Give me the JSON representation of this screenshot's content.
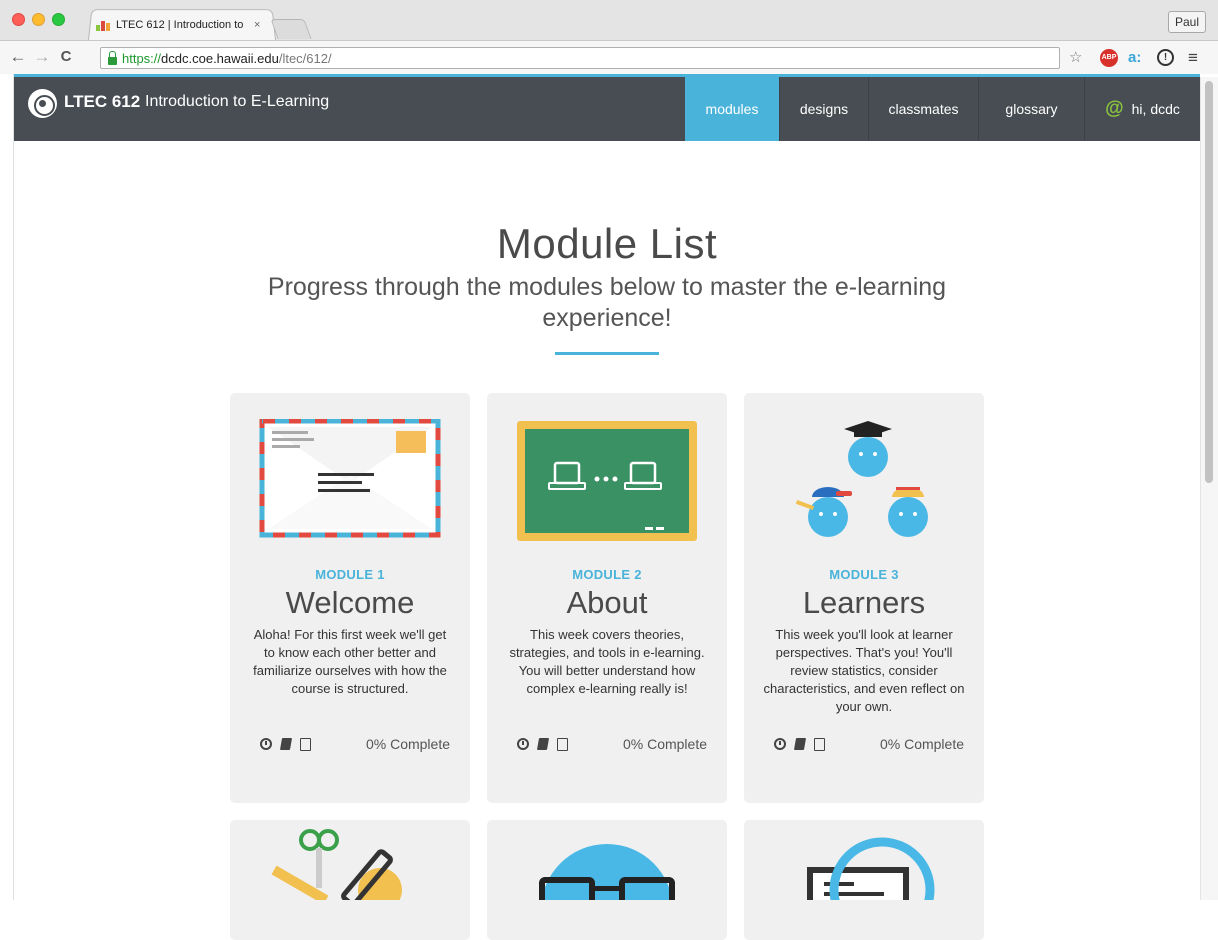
{
  "browser": {
    "tab_title": "LTEC 612 | Introduction to",
    "tab_close": "×",
    "profile": "Paul",
    "url_scheme": "https://",
    "url_host": "dcdc.coe.hawaii.edu",
    "url_path": "/ltec/612/",
    "nav_back": "←",
    "nav_forward": "→",
    "nav_reload": "C",
    "star": "☆",
    "abp": "ABP",
    "ext_a": "a:",
    "info": "!",
    "menu": "≡"
  },
  "header": {
    "course_code": "LTEC 612",
    "course_name": "Introduction to E-Learning",
    "nav": {
      "modules": "modules",
      "designs": "designs",
      "classmates": "classmates",
      "glossary": "glossary",
      "at_symbol": "@",
      "user": "hi, dcdc"
    }
  },
  "hero": {
    "title": "Module List",
    "subtitle": "Progress through the modules below to master the e-learning experience!"
  },
  "modules": [
    {
      "kicker": "MODULE 1",
      "title": "Welcome",
      "description": "Aloha! For this first week we'll get to know each other better and familiarize ourselves with how the course is structured.",
      "progress": "0% Complete"
    },
    {
      "kicker": "MODULE 2",
      "title": "About",
      "description": "This week covers theories, strategies, and tools in e-learning. You will better understand how complex e-learning really is!",
      "progress": "0% Complete"
    },
    {
      "kicker": "MODULE 3",
      "title": "Learners",
      "description": "This week you'll look at learner perspectives. That's you! You'll review statistics, consider characteristics, and even reflect on your own.",
      "progress": "0% Complete"
    }
  ],
  "colors": {
    "accent": "#4ab3d9",
    "header_bg": "#474d52",
    "card_bg": "#f0f0f0",
    "at_green": "#8cc63f"
  }
}
